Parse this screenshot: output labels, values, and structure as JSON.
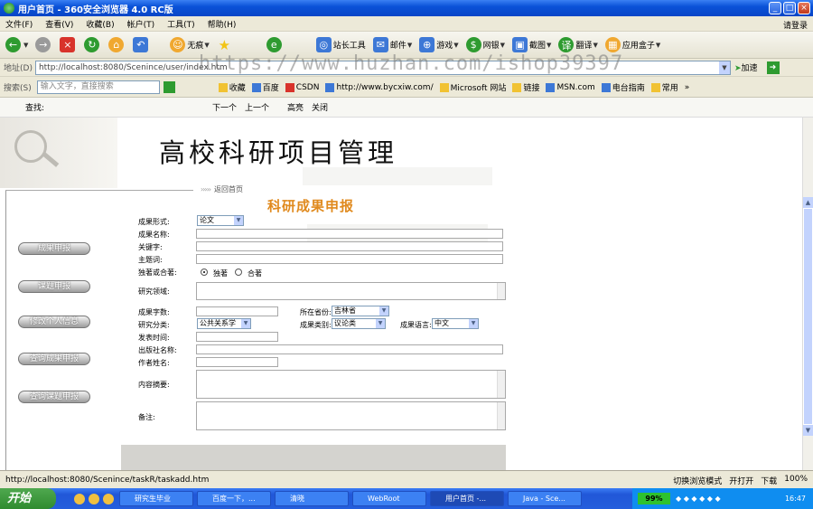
{
  "window": {
    "title": "用户首页 - 360安全浏览器 4.0 RC版"
  },
  "menu": {
    "items": [
      "文件(F)",
      "查看(V)",
      "收藏(B)",
      "帐户(T)",
      "工具(T)",
      "帮助(H)"
    ],
    "login": "请登录"
  },
  "toolbar": {
    "no_image": "无痕",
    "webmaster": "站长工具",
    "mail": "邮件",
    "game": "游戏",
    "netbank": "网银",
    "screenshot": "截图",
    "translate": "翻译",
    "app_box": "应用盒子"
  },
  "address": {
    "label": "地址(D)",
    "url": "http://localhost:8080/Scenince/user/index.htm",
    "add_label": "加速"
  },
  "watermark": "https://www.huzhan.com/ishop39397",
  "search": {
    "label": "搜索(S)",
    "placeholder": "输入文字，直接搜索"
  },
  "favorites": {
    "items": [
      "收藏",
      "百度",
      "CSDN",
      "http://www.bycxiw.com/",
      "Microsoft 网站",
      "链接",
      "MSN.com",
      "电台指南",
      "常用"
    ],
    "more": "»"
  },
  "findbar": {
    "label": "查找:",
    "next": "下一个",
    "prev": "上一个",
    "highlight": "高亮",
    "close": "关闭"
  },
  "page": {
    "system_title": "高校科研项目管理",
    "back_link": "返回首页",
    "form_title": "科研成果申报",
    "sidebar": [
      "成果申报",
      "课题申报",
      "修改个人信息",
      "查询成果申报",
      "查询课题申报"
    ]
  },
  "form": {
    "labels": {
      "form": "成果形式:",
      "name": "成果名称:",
      "keywords": "关键字:",
      "subject": "主题词:",
      "authorship": "独著或合著:",
      "field": "研究领域:",
      "word_count": "成果字数:",
      "province": "所在省份:",
      "category": "研究分类:",
      "result_type": "成果类别:",
      "language": "成果语言:",
      "publish_time": "发表时间:",
      "publisher": "出版社名称:",
      "author": "作者姓名:",
      "abstract": "内容摘要:",
      "remark": "备注:"
    },
    "values": {
      "form": "论文",
      "province": "吉林省",
      "category": "公共关系学",
      "result_type": "议论类",
      "language": "中文"
    },
    "radios": {
      "solo": "独著",
      "joint": "合著"
    }
  },
  "status": {
    "url": "http://localhost:8080/Scenince/taskR/taskadd.htm",
    "mode": "切换浏览模式",
    "open": "开打开",
    "download": "下载",
    "zoom": "100%"
  },
  "taskbar": {
    "start": "开始",
    "tasks": [
      "研究生毕业",
      "百度一下，...",
      "清晓",
      "WebRoot",
      "用户首页 -...",
      "Java - Sce..."
    ],
    "battery": "99%",
    "clock": "16:47"
  }
}
